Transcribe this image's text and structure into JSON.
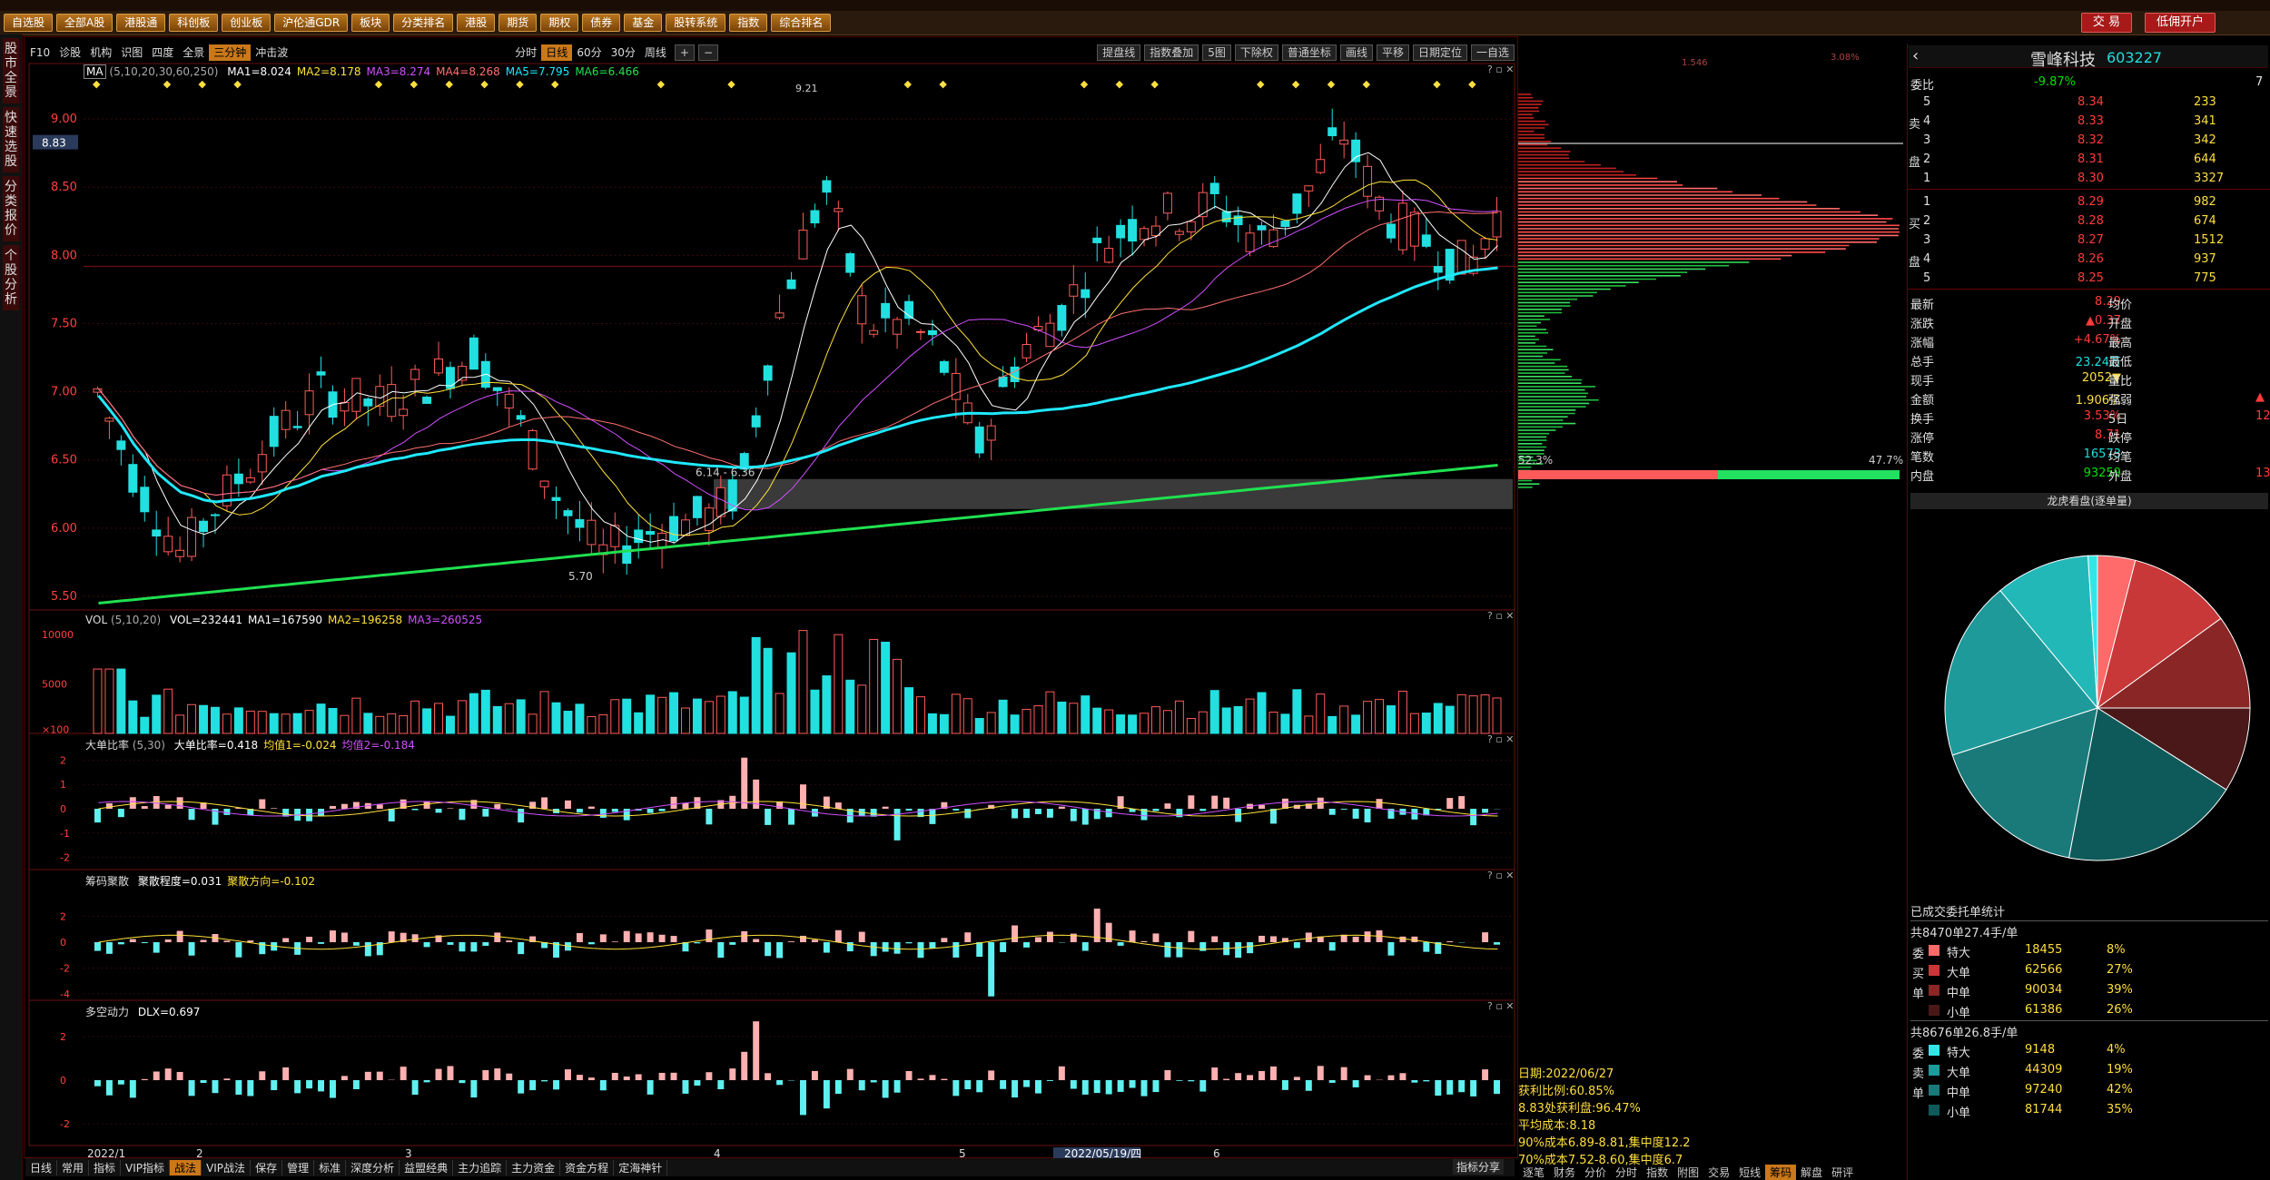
{
  "colors": {
    "up": "#ff5a5a",
    "down": "#22e0e0",
    "ma1": "#ffffff",
    "ma2": "#ffe23a",
    "ma3": "#d050ff",
    "ma4": "#ff7070",
    "ma5": "#20e8ff",
    "ma6": "#20e050",
    "accent": "#c9781a"
  },
  "nav": {
    "buttons": [
      "自选股",
      "全部A股",
      "港股通",
      "科创板",
      "创业板",
      "沪伦通GDR",
      "板块",
      "分类排名",
      "港股",
      "期货",
      "期权",
      "债券",
      "基金",
      "股转系统",
      "指数",
      "综合排名"
    ],
    "trade": "交 易",
    "open_account": "低佣开户"
  },
  "left_tabs": [
    "股市全景",
    "快速选股",
    "分类报价",
    "个股分析"
  ],
  "chart_toolbar": {
    "items": [
      "F10",
      "诊股",
      "机构",
      "识图",
      "四度",
      "全景",
      "三分钟",
      "冲击波"
    ],
    "active": "三分钟",
    "periods": [
      "分时",
      "日线",
      "60分",
      "30分",
      "周线"
    ],
    "period_active": "日线",
    "zoom_in": "+",
    "zoom_out": "−",
    "right": [
      "提盘线",
      "指数叠加",
      "5图",
      "下除权",
      "普通坐标",
      "画线",
      "平移",
      "日期定位",
      "一自选"
    ]
  },
  "main_panel": {
    "indicator": "MA",
    "params": "(5,10,20,30,60,250)",
    "ma": [
      "MA1=8.024",
      "MA2=8.178",
      "MA3=8.274",
      "MA4=8.268",
      "MA5=7.795",
      "MA6=6.466"
    ],
    "price_ticks": [
      "9.00",
      "8.50",
      "8.00",
      "7.50",
      "7.00",
      "6.50",
      "6.00",
      "5.50"
    ],
    "current_price_label": "8.83",
    "annot_low1": "5.70",
    "annot_range": "6.14 - 6.36",
    "annot_high": "9.21"
  },
  "vol_panel": {
    "header": "VOL",
    "params": "(5,10,20)",
    "values": [
      "VOL=232441",
      "MA1=167590",
      "MA2=196258",
      "MA3=260525"
    ],
    "ticks": [
      "10000",
      "5000",
      "×100"
    ]
  },
  "big_order_panel": {
    "header": "大单比率",
    "params": "(5,30)",
    "values": [
      "大单比率=0.418",
      "均值1=-0.024",
      "均值2=-0.184"
    ],
    "ticks": [
      "2",
      "1",
      "0",
      "-1",
      "-2"
    ]
  },
  "chip_panel": {
    "header": "筹码聚散",
    "values": [
      "聚散程度=0.031",
      "聚散方向=-0.102"
    ],
    "ticks": [
      "2",
      "0",
      "-2",
      "-4"
    ]
  },
  "dlx_panel": {
    "header": "多空动力",
    "values": [
      "DLX=0.697"
    ],
    "ticks": [
      "2",
      "0",
      "-2"
    ]
  },
  "x_axis": {
    "labels": [
      "2022/1",
      "2",
      "3",
      "4",
      "5",
      "6"
    ],
    "cursor_date": "2022/05/19/四",
    "left_label": "日线"
  },
  "bottom_tabs": [
    "常用",
    "指标",
    "VIP指标",
    "战法",
    "VIP战法",
    "保存",
    "管理",
    "标准",
    "深度分析",
    "益盟经典",
    "主力追踪",
    "主力资金",
    "资金方程",
    "定海神针"
  ],
  "bottom_active": "战法",
  "bottom_right": "指标分享",
  "chip_distribution": {
    "top_left": "1.546",
    "top_right": "3.08%",
    "profit": "52.3%",
    "loss": "47.7%",
    "stats": [
      "日期:2022/06/27",
      "获利比例:60.85%",
      "8.83处获利盘:96.47%",
      "平均成本:8.18",
      "90%成本6.89-8.81,集中度12.2",
      "70%成本7.52-8.60,集中度6.7"
    ],
    "tabs": [
      "逐笔",
      "财务",
      "分价",
      "分时",
      "指数",
      "附图",
      "交易",
      "短线",
      "筹码",
      "解盘",
      "研评"
    ],
    "active_tab": "筹码"
  },
  "quote": {
    "name": "雪峰科技",
    "code": "603227",
    "webi_label": "委比",
    "webi": "-9.87%",
    "webi_right": "7",
    "sell": [
      {
        "l": "5",
        "p": "8.34",
        "v": "233"
      },
      {
        "l": "4",
        "p": "8.33",
        "v": "341"
      },
      {
        "l": "3",
        "p": "8.32",
        "v": "342"
      },
      {
        "l": "2",
        "p": "8.31",
        "v": "644"
      },
      {
        "l": "1",
        "p": "8.30",
        "v": "3327"
      }
    ],
    "buy": [
      {
        "l": "1",
        "p": "8.29",
        "v": "982"
      },
      {
        "l": "2",
        "p": "8.28",
        "v": "674"
      },
      {
        "l": "3",
        "p": "8.27",
        "v": "1512"
      },
      {
        "l": "4",
        "p": "8.26",
        "v": "937"
      },
      {
        "l": "5",
        "p": "8.25",
        "v": "775"
      }
    ],
    "side_sell": [
      "卖",
      "盘"
    ],
    "side_buy": [
      "买",
      "盘"
    ],
    "stats": [
      {
        "k": "最新",
        "v": "8.29",
        "k2": "均价",
        "v2": ""
      },
      {
        "k": "涨跌",
        "v": "▲0.37",
        "k2": "开盘",
        "v2": ""
      },
      {
        "k": "涨幅",
        "v": "+4.67%",
        "k2": "最高",
        "v2": ""
      },
      {
        "k": "总手",
        "v": "23.24万",
        "k2": "最低",
        "v2": ""
      },
      {
        "k": "现手",
        "v": "2052▼",
        "k2": "量比",
        "v2": ""
      },
      {
        "k": "金额",
        "v": "1.906亿",
        "k2": "强弱",
        "v2": "▲"
      },
      {
        "k": "换手",
        "v": "3.53%",
        "k2": "5日",
        "v2": "12."
      },
      {
        "k": "涨停",
        "v": "8.71",
        "k2": "跌停",
        "v2": ""
      },
      {
        "k": "笔数",
        "v": "16573",
        "k2": "均笔",
        "v2": ""
      },
      {
        "k": "内盘",
        "v": "93259",
        "k2": "外盘",
        "v2": "13"
      }
    ],
    "dragon_title": "龙虎看盘(逐单量)",
    "pie": [
      {
        "value": 4,
        "color": "#ff6a6a"
      },
      {
        "value": 11,
        "color": "#c83838"
      },
      {
        "value": 10,
        "color": "#8a2626"
      },
      {
        "value": 9,
        "color": "#4a1818"
      },
      {
        "value": 19,
        "color": "#0e5a5a"
      },
      {
        "value": 17,
        "color": "#1a7a7a"
      },
      {
        "value": 19,
        "color": "#1e9a9a"
      },
      {
        "value": 10,
        "color": "#22b8b8"
      },
      {
        "value": 1,
        "color": "#33e6e6"
      }
    ],
    "order_stats_title": "已成交委托单统计",
    "buy_total": "共8470单27.4手/单",
    "buy_side": [
      "委",
      "买",
      "单"
    ],
    "buy_rows": [
      {
        "n": "特大",
        "v": "18455",
        "p": "8%",
        "c": "#ff6a6a"
      },
      {
        "n": "大单",
        "v": "62566",
        "p": "27%",
        "c": "#c83838"
      },
      {
        "n": "中单",
        "v": "90034",
        "p": "39%",
        "c": "#8a2626"
      },
      {
        "n": "小单",
        "v": "61386",
        "p": "26%",
        "c": "#4a1818"
      }
    ],
    "sell_total": "共8676单26.8手/单",
    "sell_side": [
      "委",
      "卖",
      "单"
    ],
    "sell_rows": [
      {
        "n": "特大",
        "v": "9148",
        "p": "4%",
        "c": "#33e6e6"
      },
      {
        "n": "大单",
        "v": "44309",
        "p": "19%",
        "c": "#1e9a9a"
      },
      {
        "n": "中单",
        "v": "97240",
        "p": "42%",
        "c": "#1a7a7a"
      },
      {
        "n": "小单",
        "v": "81744",
        "p": "35%",
        "c": "#0e5a5a"
      }
    ]
  }
}
